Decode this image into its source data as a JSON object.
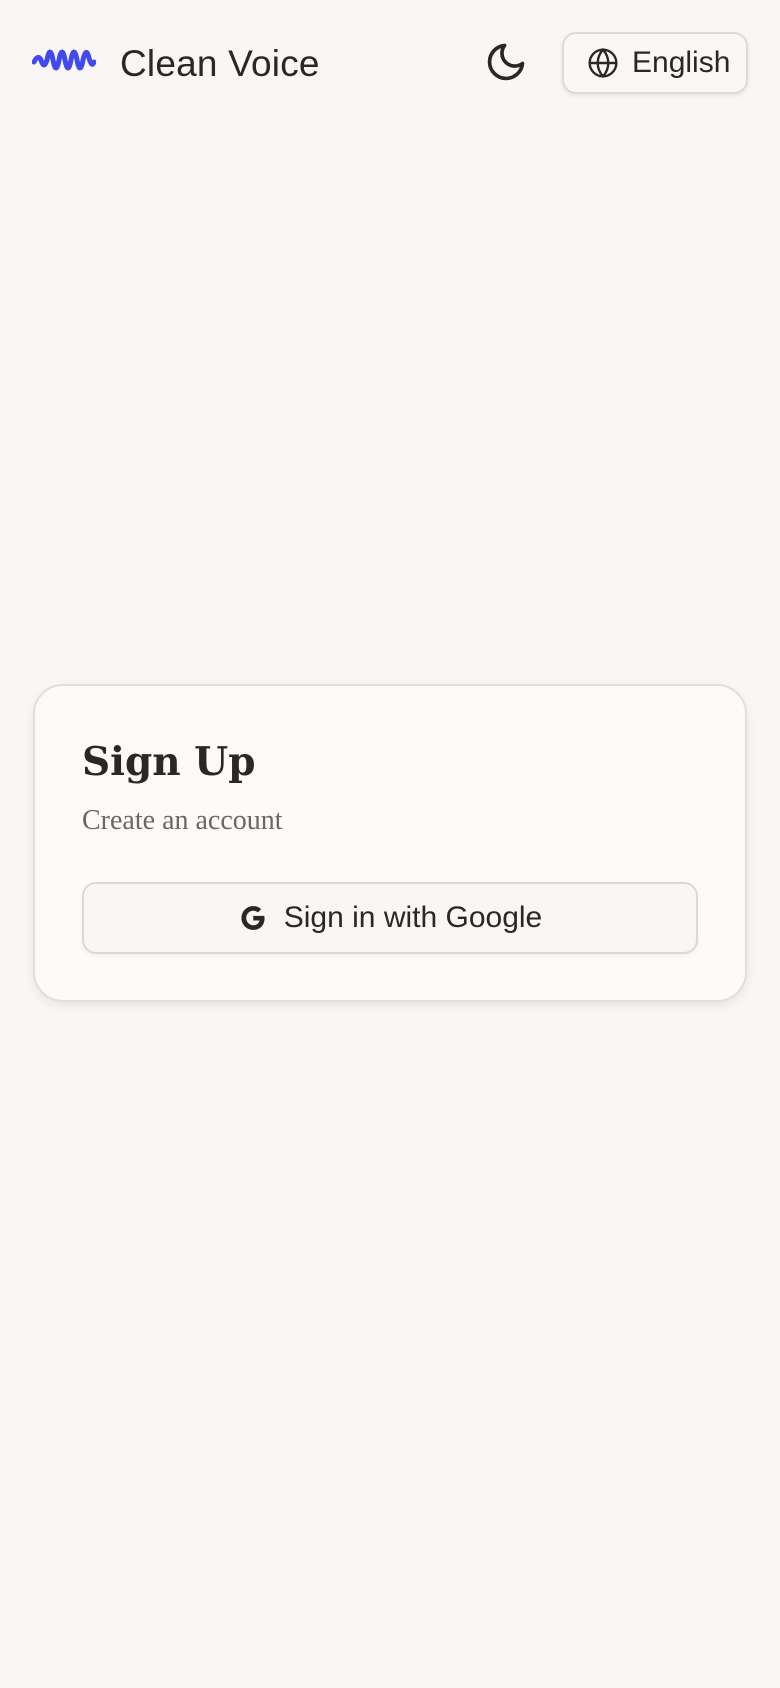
{
  "header": {
    "brand_name": "Clean Voice",
    "brand_color": "#4349f0",
    "logo_icon": "soundwave-icon",
    "theme_toggle_icon": "moon-icon",
    "language": {
      "icon": "globe-icon",
      "label": "English"
    }
  },
  "signup_card": {
    "title": "Sign Up",
    "subtitle": "Create an account",
    "google_button": {
      "icon": "google-icon",
      "label": "Sign in with Google"
    }
  }
}
